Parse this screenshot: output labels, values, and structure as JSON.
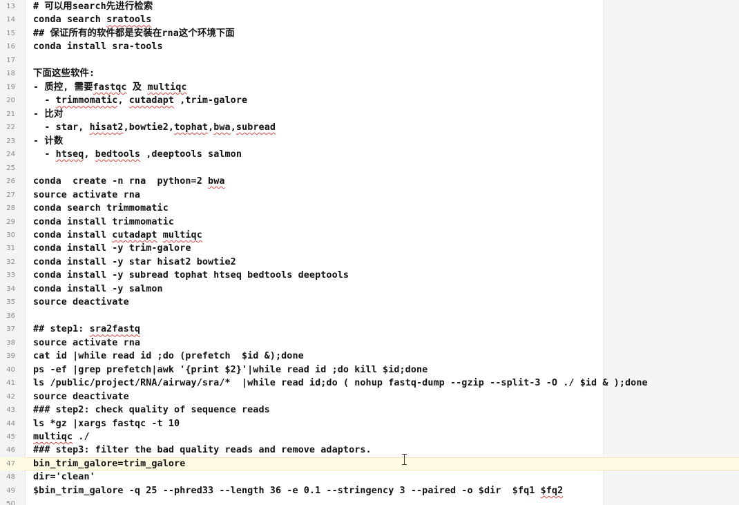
{
  "editor": {
    "lines": [
      {
        "num": "13",
        "segs": [
          {
            "t": "# 可以用search先进行检索"
          }
        ]
      },
      {
        "num": "14",
        "segs": [
          {
            "t": "conda search "
          },
          {
            "t": "sratools",
            "u": true
          }
        ]
      },
      {
        "num": "15",
        "segs": [
          {
            "t": "## 保证所有的软件都是安装在rna这个环境下面"
          }
        ]
      },
      {
        "num": "16",
        "segs": [
          {
            "t": "conda install sra-tools"
          }
        ]
      },
      {
        "num": "17",
        "segs": []
      },
      {
        "num": "18",
        "segs": [
          {
            "t": "下面这些软件:"
          }
        ]
      },
      {
        "num": "19",
        "segs": [
          {
            "t": "- 质控, 需要"
          },
          {
            "t": "fastqc",
            "u": true
          },
          {
            "t": " 及 "
          },
          {
            "t": "multiqc",
            "u": true
          }
        ]
      },
      {
        "num": "20",
        "segs": [
          {
            "t": "  - "
          },
          {
            "t": "trimmomatic",
            "u": true
          },
          {
            "t": ", "
          },
          {
            "t": "cutadapt",
            "u": true
          },
          {
            "t": " ,trim-galore"
          }
        ]
      },
      {
        "num": "21",
        "segs": [
          {
            "t": "- 比对"
          }
        ]
      },
      {
        "num": "22",
        "segs": [
          {
            "t": "  - star, "
          },
          {
            "t": "hisat2",
            "u": true
          },
          {
            "t": ",bowtie2,"
          },
          {
            "t": "tophat",
            "u": true
          },
          {
            "t": ","
          },
          {
            "t": "bwa",
            "u": true
          },
          {
            "t": ","
          },
          {
            "t": "subread",
            "u": true
          }
        ]
      },
      {
        "num": "23",
        "segs": [
          {
            "t": "- 计数"
          }
        ]
      },
      {
        "num": "24",
        "segs": [
          {
            "t": "  - "
          },
          {
            "t": "htseq",
            "u": true
          },
          {
            "t": ", "
          },
          {
            "t": "bedtools",
            "u": true
          },
          {
            "t": " ,deeptools salmon"
          }
        ]
      },
      {
        "num": "25",
        "segs": []
      },
      {
        "num": "26",
        "segs": [
          {
            "t": "conda  create -n rna  python=2 "
          },
          {
            "t": "bwa",
            "u": true
          }
        ]
      },
      {
        "num": "27",
        "segs": [
          {
            "t": "source activate rna"
          }
        ]
      },
      {
        "num": "28",
        "segs": [
          {
            "t": "conda search trimmomatic"
          }
        ]
      },
      {
        "num": "29",
        "segs": [
          {
            "t": "conda install trimmomatic"
          }
        ]
      },
      {
        "num": "30",
        "segs": [
          {
            "t": "conda install "
          },
          {
            "t": "cutadapt",
            "u": true
          },
          {
            "t": " "
          },
          {
            "t": "multiqc",
            "u": true
          }
        ]
      },
      {
        "num": "31",
        "segs": [
          {
            "t": "conda install -y trim-galore"
          }
        ]
      },
      {
        "num": "32",
        "segs": [
          {
            "t": "conda install -y star hisat2 bowtie2"
          }
        ]
      },
      {
        "num": "33",
        "segs": [
          {
            "t": "conda install -y subread tophat htseq bedtools deeptools"
          }
        ]
      },
      {
        "num": "34",
        "segs": [
          {
            "t": "conda install -y salmon"
          }
        ]
      },
      {
        "num": "35",
        "segs": [
          {
            "t": "source deactivate"
          }
        ]
      },
      {
        "num": "36",
        "segs": []
      },
      {
        "num": "37",
        "segs": [
          {
            "t": "## step1: "
          },
          {
            "t": "sra2fastq",
            "u": true
          }
        ]
      },
      {
        "num": "38",
        "segs": [
          {
            "t": "source activate rna"
          }
        ]
      },
      {
        "num": "39",
        "segs": [
          {
            "t": "cat id |while read id ;do (prefetch  $id &);done"
          }
        ]
      },
      {
        "num": "40",
        "segs": [
          {
            "t": "ps -ef |grep prefetch|awk '{print $2}'|while read id ;do kill $id;done"
          }
        ]
      },
      {
        "num": "41",
        "segs": [
          {
            "t": "ls /public/project/RNA/airway/sra/*  |while read id;do ( nohup fastq-dump --gzip --split-3 -O ./ $id & );done"
          }
        ]
      },
      {
        "num": "42",
        "segs": [
          {
            "t": "source deactivate"
          }
        ]
      },
      {
        "num": "43",
        "segs": [
          {
            "t": "### step2: check quality of sequence reads"
          }
        ]
      },
      {
        "num": "44",
        "segs": [
          {
            "t": "ls *gz |xargs fastqc -t 10"
          }
        ]
      },
      {
        "num": "45",
        "segs": [
          {
            "t": "multiqc",
            "u": true
          },
          {
            "t": " ./"
          }
        ]
      },
      {
        "num": "46",
        "segs": [
          {
            "t": "### step3: filter the bad quality reads and remove adaptors."
          }
        ]
      },
      {
        "num": "47",
        "current": true,
        "segs": [
          {
            "t": "bin_trim_galore=trim_galore"
          }
        ]
      },
      {
        "num": "48",
        "segs": [
          {
            "t": "dir='clean'"
          }
        ]
      },
      {
        "num": "49",
        "segs": [
          {
            "t": "$bin_trim_galore -q 25 --phred33 --length 36 -e 0.1 --stringency 3 --paired -o $dir  $fq1 "
          },
          {
            "t": "$fq2",
            "u": true
          }
        ]
      },
      {
        "num": "50",
        "segs": []
      }
    ]
  }
}
